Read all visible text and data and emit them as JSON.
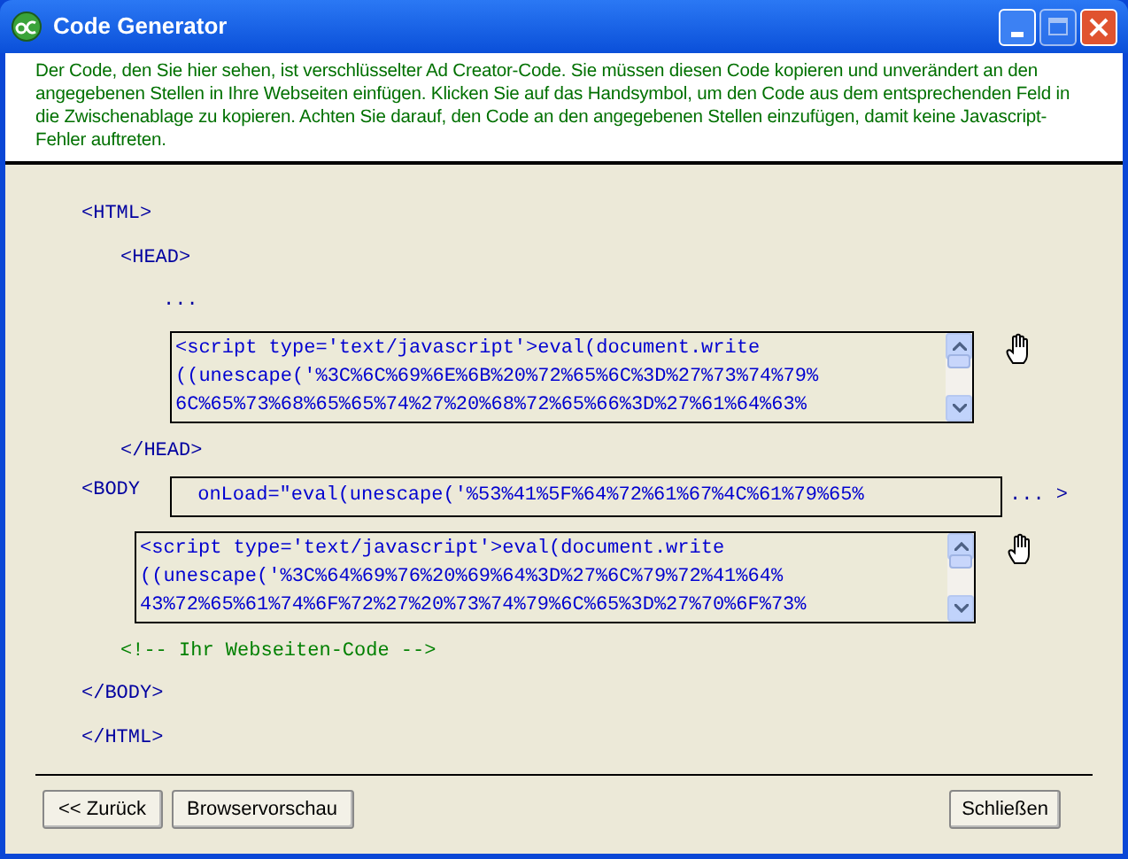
{
  "window": {
    "title": "Code Generator"
  },
  "intro": "Der Code, den Sie hier sehen, ist verschlüsselter Ad Creator-Code. Sie müssen diesen Code kopieren und unverändert an den angegebenen Stellen in Ihre Webseiten einfügen. Klicken Sie auf das Handsymbol, um den Code aus dem entsprechenden Feld in die Zwischenablage zu kopieren. Achten Sie darauf, den Code an den angegebenen Stellen einzufügen, damit keine Javascript-Fehler auftreten.",
  "code": [
    {
      "kind": "tag",
      "text": "<HTML>",
      "children": [
        {
          "kind": "tag",
          "text": "<HEAD>",
          "children": [
            {
              "kind": "tag",
              "text": "..."
            },
            {
              "kind": "box",
              "lines": [
                "<script type='text/javascript'>eval(document.write",
                "((unescape('%3C%6C%69%6E%6B%20%72%65%6C%3D%27%73%74%79%",
                "6C%65%73%68%65%65%74%27%20%68%72%65%66%3D%27%61%64%63%"
              ]
            }
          ]
        },
        {
          "kind": "tag",
          "text": "</HEAD>"
        }
      ]
    },
    {
      "kind": "body",
      "label": "<BODY",
      "value": " onLoad=\"eval(unescape('%53%41%5F%64%72%61%67%4C%61%79%65%",
      "suffix": "... >",
      "children": [
        {
          "kind": "box",
          "lines": [
            "<script type='text/javascript'>eval(document.write",
            "((unescape('%3C%64%69%76%20%69%64%3D%27%6C%79%72%41%64%",
            "43%72%65%61%74%6F%72%27%20%73%74%79%6C%65%3D%27%70%6F%73%"
          ]
        },
        {
          "kind": "comment",
          "text": "<!-- Ihr Webseiten-Code -->"
        }
      ]
    },
    {
      "kind": "tag",
      "text": "</BODY>"
    },
    {
      "kind": "tag",
      "text": "</HTML>"
    }
  ],
  "buttons_left": [
    "<< Zurück",
    "Browservorschau"
  ],
  "buttons_right": [
    "Schließen"
  ]
}
